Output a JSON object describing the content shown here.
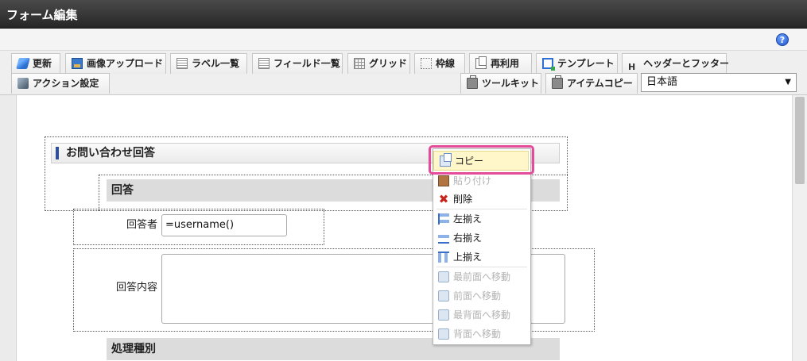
{
  "window": {
    "title": "フォーム編集"
  },
  "help": {
    "glyph": "?"
  },
  "toolbar": {
    "update": "更新",
    "image_upload": "画像アップロード",
    "label_list": "ラベル一覧",
    "field_list": "フィールド一覧",
    "grid": "グリッド",
    "frame": "枠線",
    "reuse": "再利用",
    "template": "テンプレート",
    "header_footer": "ヘッダーとフッター",
    "action_settings": "アクション設定",
    "toolkit": "ツールキット",
    "item_copy": "アイテムコピー",
    "header_glyph": "H",
    "language": {
      "value": "日本語",
      "arrow": "▼"
    }
  },
  "form": {
    "section_title": "お問い合わせ回答",
    "answer_header": "回答",
    "respondent_label": "回答者",
    "respondent_value": "=username()",
    "content_label": "回答内容",
    "processing_header": "処理種別"
  },
  "context_menu": {
    "copy": "コピー",
    "paste": "貼り付け",
    "delete": "削除",
    "align_left": "左揃え",
    "align_right": "右揃え",
    "align_top": "上揃え",
    "bring_front": "最前面へ移動",
    "forward": "前面へ移動",
    "send_back": "最背面へ移動",
    "backward": "背面へ移動",
    "delete_glyph": "✖"
  },
  "colors": {
    "highlight_border": "#e44b9a",
    "active_item_bg": "#fff7c9",
    "titlebar": "#333333"
  }
}
